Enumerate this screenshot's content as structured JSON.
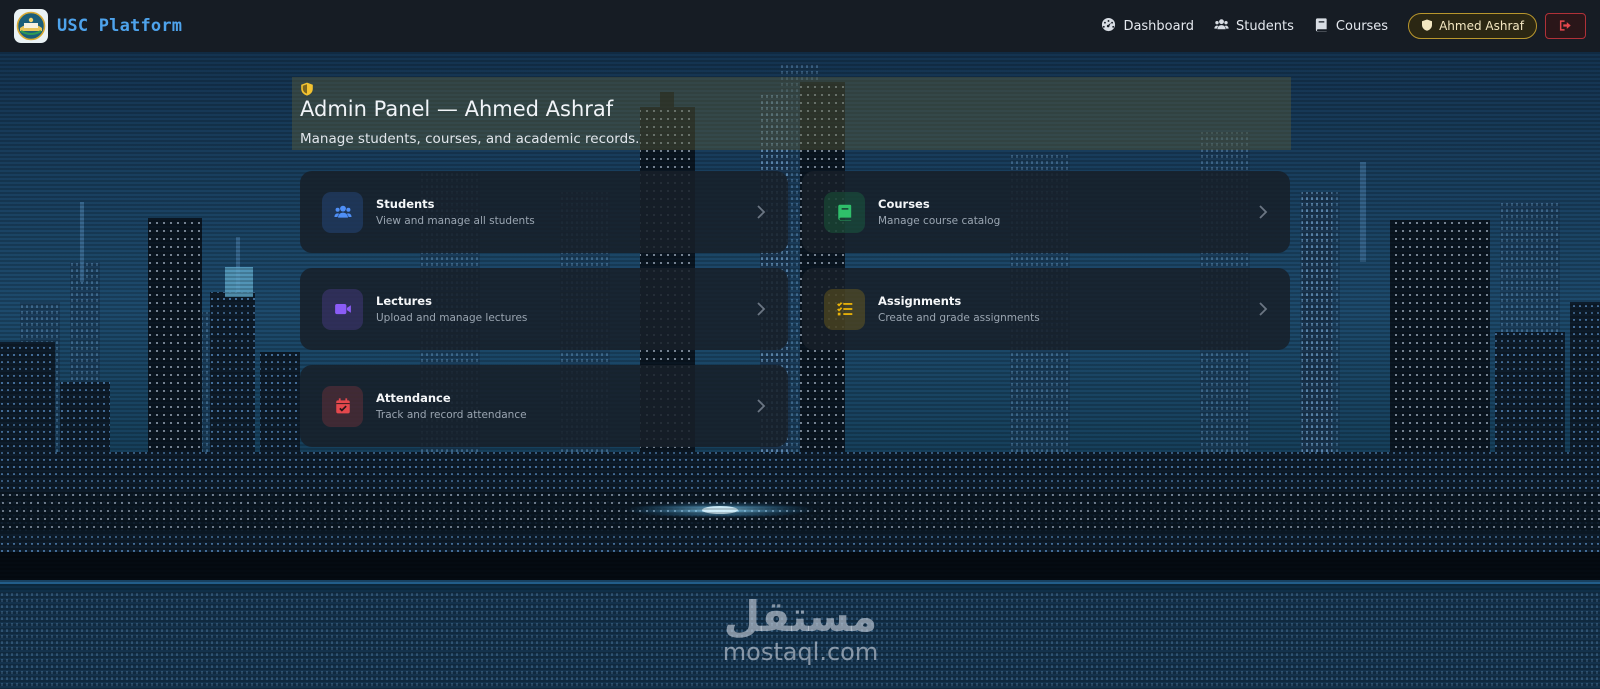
{
  "navbar": {
    "brand": "USC Platform",
    "links": [
      {
        "label": "Dashboard",
        "icon": "gauge-icon"
      },
      {
        "label": "Students",
        "icon": "users-icon"
      },
      {
        "label": "Courses",
        "icon": "book-icon"
      }
    ],
    "user_label": "Ahmed Ashraf",
    "logout_icon": "sign-out-icon"
  },
  "header": {
    "title": "Admin Panel — Ahmed Ashraf",
    "subtitle": "Manage students, courses, and academic records."
  },
  "cards": [
    {
      "title": "Students",
      "desc": "View and manage all students",
      "icon": "users-icon",
      "color": "#3b82f6"
    },
    {
      "title": "Courses",
      "desc": "Manage course catalog",
      "icon": "book-icon",
      "color": "#22c55e"
    },
    {
      "title": "Lectures",
      "desc": "Upload and manage lectures",
      "icon": "video-icon",
      "color": "#8b5cf6"
    },
    {
      "title": "Assignments",
      "desc": "Create and grade assignments",
      "icon": "tasks-icon",
      "color": "#eab308"
    },
    {
      "title": "Attendance",
      "desc": "Track and record attendance",
      "icon": "calendar-check-icon",
      "color": "#e5484d"
    }
  ],
  "watermark": {
    "arabic": "مستقل",
    "latin": "mostaql.com"
  },
  "colors": {
    "brand": "#4ea3ec",
    "navbar_bg": "#161c24",
    "user_pill_border": "#b8962d",
    "logout_red": "#e5484d",
    "admin_gold": "#f2c230"
  }
}
